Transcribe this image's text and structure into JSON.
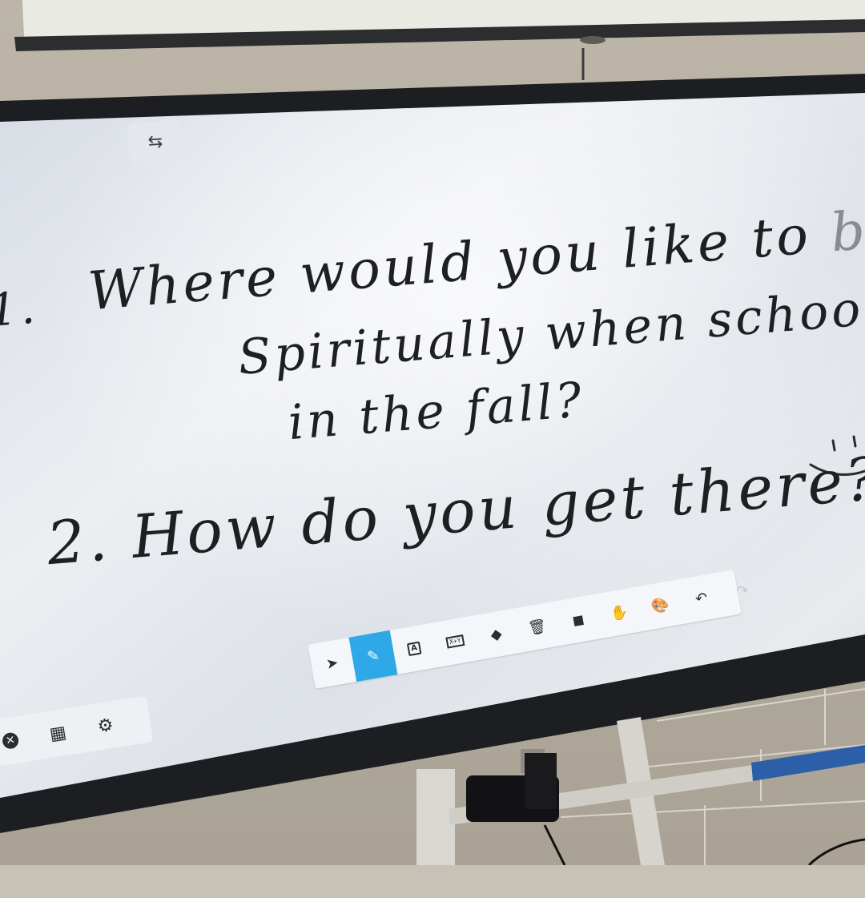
{
  "whiteboard": {
    "question1": {
      "number": "1.",
      "line1_main": "Where would you like to ",
      "line1_faded": "be",
      "line2": "Spiritually when school starts",
      "line3": "in the fall?"
    },
    "question2": {
      "number": "2.",
      "text": "How do you get there?"
    }
  },
  "toolbar": {
    "tools": [
      {
        "name": "select-tool",
        "icon": "cursor-arrow-icon",
        "glyph": "➤",
        "state": "normal"
      },
      {
        "name": "pen-tool",
        "icon": "pencil-icon",
        "glyph": "✎",
        "state": "active"
      },
      {
        "name": "text-tool",
        "icon": "text-box-icon",
        "glyph": "A",
        "state": "normal"
      },
      {
        "name": "formula-tool",
        "icon": "formula-icon",
        "glyph": "X+Y",
        "state": "normal"
      },
      {
        "name": "eraser-tool",
        "icon": "eraser-icon",
        "glyph": "◆",
        "state": "normal"
      },
      {
        "name": "clear-tool",
        "icon": "trash-icon",
        "glyph": "🗑",
        "state": "normal"
      },
      {
        "name": "shape-tool",
        "icon": "shapes-icon",
        "glyph": "◼",
        "state": "normal"
      },
      {
        "name": "pan-tool",
        "icon": "hand-icon",
        "glyph": "✋",
        "state": "normal"
      },
      {
        "name": "color-tool",
        "icon": "palette-icon",
        "glyph": "🎨",
        "state": "normal"
      },
      {
        "name": "undo-tool",
        "icon": "undo-icon",
        "glyph": "↶",
        "state": "normal"
      },
      {
        "name": "redo-tool",
        "icon": "redo-icon",
        "glyph": "↷",
        "state": "disabled"
      }
    ],
    "active_color": "#2ea8e6"
  },
  "bottom_panel": {
    "buttons": [
      {
        "name": "close-button",
        "icon": "close-circle-icon",
        "glyph": "✕"
      },
      {
        "name": "qr-code-button",
        "icon": "qr-code-icon",
        "glyph": "▦"
      },
      {
        "name": "settings-button",
        "icon": "gear-icon",
        "glyph": "⚙"
      }
    ]
  },
  "swap_button": {
    "icon": "swap-arrows-icon",
    "glyph": "⇆"
  }
}
